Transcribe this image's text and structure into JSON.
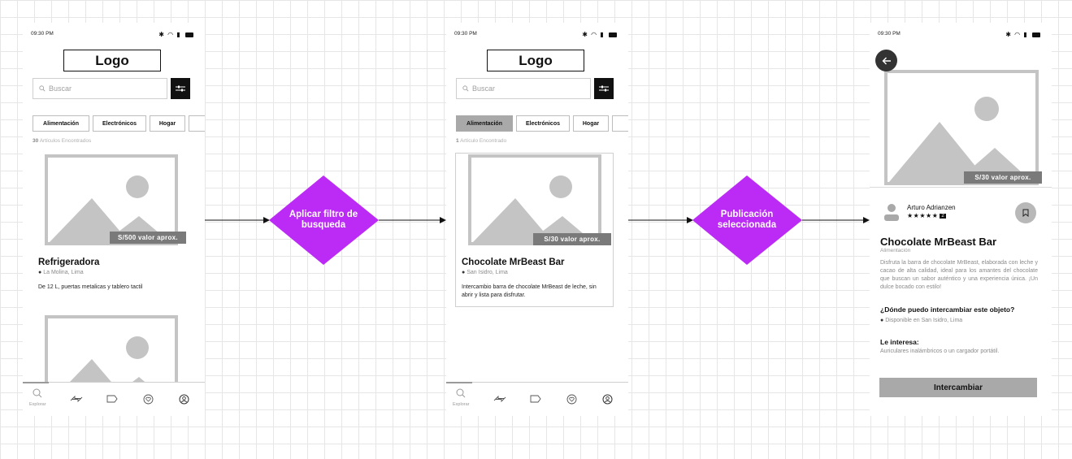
{
  "screens": [
    {
      "status_time": "09:30 PM",
      "logo": "Logo",
      "search_placeholder": "Buscar",
      "categories": [
        "Alimentación",
        "Electrónicos",
        "Hogar"
      ],
      "count_number": "30",
      "count_label": "Artículos Encontrados",
      "card": {
        "price": "S/500 valor aprox.",
        "title": "Refrigeradora",
        "location": "La Molina, Lima",
        "description": "De 12 L, puertas metalicas y tablero tactil"
      },
      "tabbar_label": "Explorar"
    },
    {
      "status_time": "09:30 PM",
      "logo": "Logo",
      "search_placeholder": "Buscar",
      "categories": [
        "Alimentación",
        "Electrónicos",
        "Hogar"
      ],
      "count_number": "1",
      "count_label": "Artículo Encontrado",
      "card": {
        "price": "S/30 valor aprox.",
        "title": "Chocolate MrBeast Bar",
        "location": "San Isidro, Lima",
        "description": "Intercambio barra de chocolate MrBeast de leche, sin abrir y lista para disfrutar."
      },
      "tabbar_label": "Explorar"
    },
    {
      "status_time": "09:30 PM",
      "price": "S/30 valor aprox.",
      "seller": {
        "name": "Arturo Adrianzen",
        "stars": "★★★★★",
        "rating": "2"
      },
      "title": "Chocolate MrBeast Bar",
      "category": "Alimentación",
      "description": "Disfruta la barra de chocolate MrBeast, elaborada con leche y cacao de alta calidad, ideal para los amantes del chocolate que buscan un sabor auténtico y una experiencia única. ¡Un dulce bocado con estilo!",
      "question": "¿Dónde puedo intercambiar este objeto?",
      "availability": "Disponible en San Isidro, Lima",
      "interest_label": "Le interesa:",
      "interest_value": "Auriculares inalámbricos o un cargador portátil.",
      "button": "Intercambiar"
    }
  ],
  "flow_steps": [
    "Aplicar filtro de\nbusqueda",
    "Publicación\nseleccionada"
  ],
  "colors": {
    "diamond": "#bb2bf5",
    "price_tag": "#7a7a7a",
    "placeholder": "#c4c4c4",
    "active_chip": "#a9a9a9"
  }
}
